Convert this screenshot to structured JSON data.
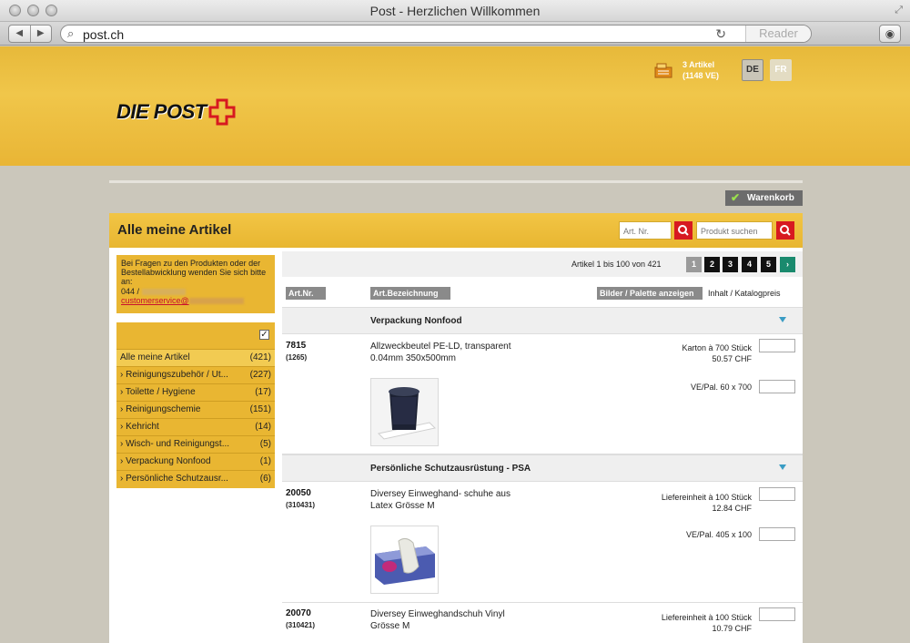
{
  "window": {
    "title": "Post - Herzlichen Willkommen"
  },
  "toolbar": {
    "url": "post.ch",
    "reader": "Reader"
  },
  "header": {
    "logo_text": "DIE POST",
    "cart": {
      "line1": "3 Artikel",
      "line2": "(1148 VE)"
    },
    "languages": [
      "DE",
      "FR"
    ]
  },
  "warenkorb": "Warenkorb",
  "panel": {
    "title": "Alle meine Artikel",
    "art_nr_placeholder": "Art. Nr.",
    "product_placeholder": "Produkt suchen"
  },
  "help": {
    "text": "Bei Fragen zu den Produkten oder der Bestellabwicklung wenden Sie sich bitte an:",
    "phone": "044 / ",
    "email": "customerservice@"
  },
  "categories": [
    {
      "label": "Alle meine Artikel",
      "count": "(421)"
    },
    {
      "label": "› Reinigungszubehör / Ut...",
      "count": "(227)"
    },
    {
      "label": "› Toilette / Hygiene",
      "count": "(17)"
    },
    {
      "label": "› Reinigungschemie",
      "count": "(151)"
    },
    {
      "label": "› Kehricht",
      "count": "(14)"
    },
    {
      "label": "› Wisch- und Reinigungst...",
      "count": "(5)"
    },
    {
      "label": "› Verpackung Nonfood",
      "count": "(1)"
    },
    {
      "label": "› Persönliche Schutzausr...",
      "count": "(6)"
    }
  ],
  "pager": {
    "text": "Artikel 1 bis 100 von 421",
    "pages": [
      "1",
      "2",
      "3",
      "4",
      "5"
    ],
    "next": "›"
  },
  "columns": {
    "art_nr": "Art.Nr.",
    "bezeichnung": "Art.Bezeichnung",
    "bilder": "Bilder / Palette anzeigen",
    "inhalt": "Inhalt / Katalogpreis"
  },
  "groups": [
    {
      "title": "Verpackung Nonfood",
      "article": {
        "nr": "7815",
        "sub": "(1265)",
        "desc1": "Allzweckbeutel PE-LD, transparent",
        "desc2": "0.04mm 350x500mm",
        "pack1": "Karton à 700 Stück",
        "price": "50.57 CHF",
        "pallet": "VE/Pal. 60 x 700"
      }
    },
    {
      "title": "Persönliche Schutzausrüstung - PSA",
      "article": {
        "nr": "20050",
        "sub": "(310431)",
        "desc1": "Diversey Einweghand- schuhe aus",
        "desc2": "Latex Grösse M",
        "pack1": "Liefereinheit à 100 Stück",
        "price": "12.84 CHF",
        "pallet": "VE/Pal. 405 x 100"
      }
    }
  ],
  "extra_article": {
    "nr": "20070",
    "sub": "(310421)",
    "desc1": "Diversey Einweghandschuh Vinyl",
    "desc2": "Grösse M",
    "pack1": "Liefereinheit à 100 Stück",
    "price": "10.79 CHF"
  },
  "colors": {
    "brand_yellow": "#f0c64a",
    "brand_red": "#d71920",
    "pager_next": "#1a8a6e"
  }
}
